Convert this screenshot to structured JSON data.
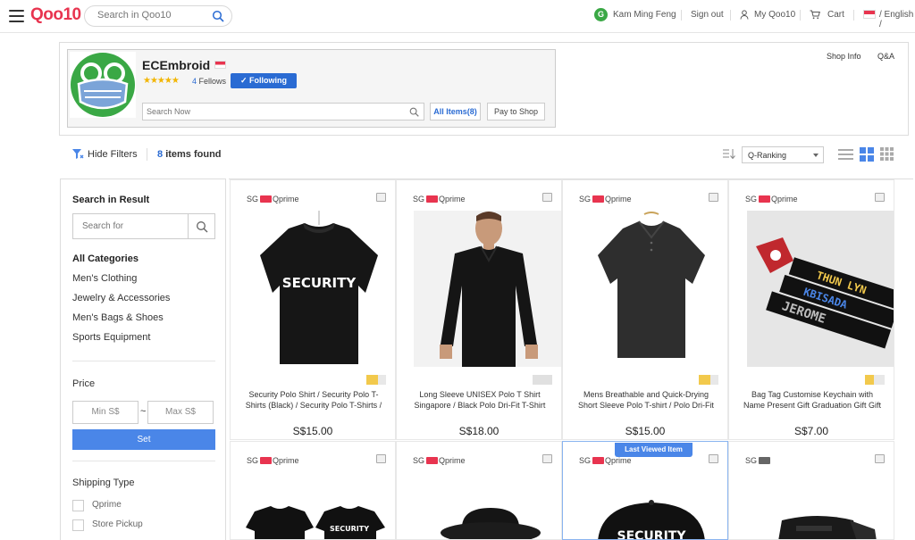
{
  "header": {
    "logo": "Qoo10",
    "search_placeholder": "Search in Qoo10",
    "user_initial": "G",
    "user_name": "Kam Ming Feng",
    "sign_out": "Sign out",
    "my_qoo10": "My Qoo10",
    "cart": "Cart",
    "language": "/ English /"
  },
  "shop": {
    "name": "ECEmbroid",
    "fellows_count": "4",
    "fellows_label": "Fellows",
    "follow_button": "Following",
    "search_placeholder": "Search Now",
    "all_items": "All Items(8)",
    "pay_to_shop": "Pay to Shop",
    "shop_info": "Shop Info",
    "qa": "Q&A"
  },
  "filterbar": {
    "hide_filters": "Hide Filters",
    "items_count": "8",
    "items_found_label": "items found",
    "sort_value": "Q-Ranking"
  },
  "sidebar": {
    "search_title": "Search in Result",
    "search_placeholder": "Search for",
    "categories_title": "All Categories",
    "categories": [
      "Men's Clothing",
      "Jewelry & Accessories",
      "Men's Bags & Shoes",
      "Sports Equipment"
    ],
    "price_title": "Price",
    "min_placeholder": "Min S$",
    "tilde": "~",
    "max_placeholder": "Max S$",
    "set_button": "Set",
    "shipping_title": "Shipping Type",
    "shipping_options": [
      "Qprime",
      "Store Pickup"
    ]
  },
  "products": [
    {
      "country": "SG",
      "badge": "Qprime",
      "title": "Security Polo Shirt / Security Polo T-Shirts (Black) / Security Polo T-Shirts / Securit...",
      "price": "S$15.00",
      "print": "SECURITY"
    },
    {
      "country": "SG",
      "badge": "Qprime",
      "title": "Long Sleeve UNISEX Polo T Shirt Singapore / Black Polo Dri-Fit T-Shirt /...",
      "price": "S$18.00"
    },
    {
      "country": "SG",
      "badge": "Qprime",
      "title": "Mens Breathable and Quick-Drying Short Sleeve Polo T-shirt / Polo Dri-Fit T-Shirt",
      "price": "S$15.00"
    },
    {
      "country": "SG",
      "badge": "Qprime",
      "title": "Bag Tag Customise Keychain with Name Present Gift Graduation Gift Gift Tag...",
      "price": "S$7.00",
      "tags": [
        "THUN LYN",
        "KBISADA",
        "JEROME"
      ]
    },
    {
      "country": "SG",
      "badge": "Qprime",
      "print": "SECURITY"
    },
    {
      "country": "SG",
      "badge": "Qprime"
    },
    {
      "country": "SG",
      "badge": "Qprime",
      "print": "SECURITY"
    },
    {
      "country": "SG",
      "badge": ""
    }
  ],
  "last_viewed_label": "Last Viewed Item",
  "colors": {
    "brand": "#e8344f",
    "accent": "#2a6bd3",
    "set_button": "#4a86e8"
  }
}
